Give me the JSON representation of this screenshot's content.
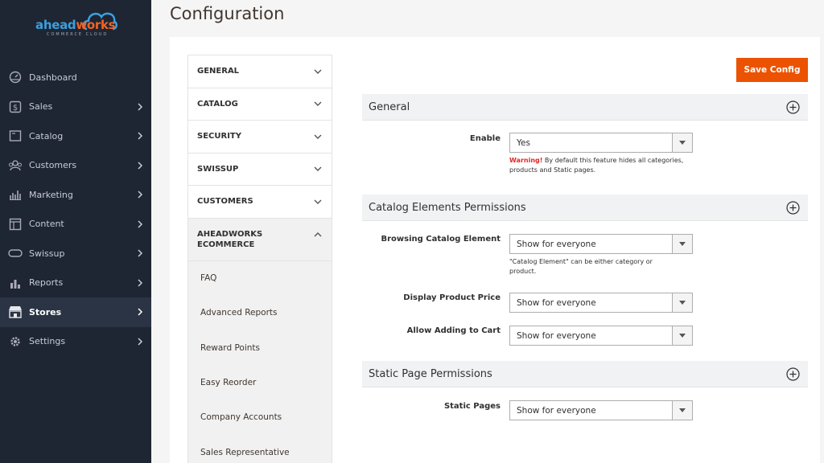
{
  "brand": {
    "part1": "ahead",
    "part2": "works",
    "tagline": "COMMERCE CLOUD"
  },
  "sidebar": {
    "items": [
      {
        "label": "Dashboard",
        "icon": "dashboard-icon"
      },
      {
        "label": "Sales",
        "icon": "dollar-icon"
      },
      {
        "label": "Catalog",
        "icon": "catalog-icon"
      },
      {
        "label": "Customers",
        "icon": "customers-icon"
      },
      {
        "label": "Marketing",
        "icon": "marketing-icon"
      },
      {
        "label": "Content",
        "icon": "content-icon"
      },
      {
        "label": "Swissup",
        "icon": "swissup-icon"
      },
      {
        "label": "Reports",
        "icon": "reports-icon"
      },
      {
        "label": "Stores",
        "icon": "stores-icon"
      },
      {
        "label": "Settings",
        "icon": "gear-icon"
      }
    ]
  },
  "page": {
    "title": "Configuration",
    "save_label": "Save Config"
  },
  "tabs": {
    "items": [
      {
        "label": "GENERAL"
      },
      {
        "label": "CATALOG"
      },
      {
        "label": "SECURITY"
      },
      {
        "label": "SWISSUP"
      },
      {
        "label": "CUSTOMERS"
      }
    ],
    "open_line1": "AHEADWORKS",
    "open_line2": "ECOMMERCE",
    "subitems": [
      {
        "label": "FAQ"
      },
      {
        "label": "Advanced Reports"
      },
      {
        "label": "Reward Points"
      },
      {
        "label": "Easy Reorder"
      },
      {
        "label": "Company Accounts"
      },
      {
        "label": "Sales Representative"
      }
    ]
  },
  "sections": {
    "general": {
      "title": "General",
      "enable_label": "Enable",
      "enable_value": "Yes",
      "warning_prefix": "Warning!",
      "warning_text": " By default this feature hides all categories, products and Static pages."
    },
    "catalog": {
      "title": "Catalog Elements Permissions",
      "browsing_label": "Browsing Catalog Element",
      "browsing_value": "Show for everyone",
      "browsing_note": "\"Catalog Element\" can be either category or product.",
      "price_label": "Display Product Price",
      "price_value": "Show for everyone",
      "cart_label": "Allow Adding to Cart",
      "cart_value": "Show for everyone"
    },
    "static": {
      "title": "Static Page Permissions",
      "pages_label": "Static Pages",
      "pages_value": "Show for everyone"
    }
  },
  "colors": {
    "sidebar_bg": "#1e2533",
    "accent": "#eb5202",
    "warning": "#e22626"
  }
}
